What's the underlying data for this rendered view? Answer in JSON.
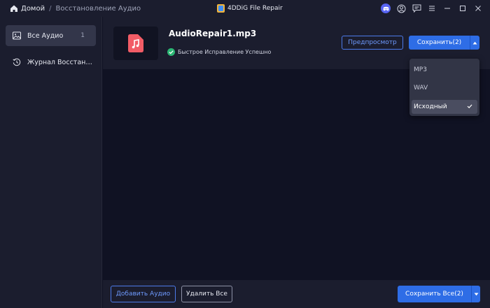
{
  "titlebar": {
    "home_label": "Домой",
    "separator": "/",
    "current_page": "Восстановление Аудио",
    "app_name": "4DDiG File Repair",
    "icons": [
      "discord-icon",
      "user-icon",
      "feedback-icon",
      "menu-icon",
      "minimize-icon",
      "maximize-icon",
      "close-icon"
    ]
  },
  "sidebar": {
    "items": [
      {
        "label": "Все Аудио",
        "count": "1",
        "icon": "image-icon",
        "active": true
      },
      {
        "label": "Журнал Восстановления",
        "icon": "history-icon",
        "active": false
      }
    ]
  },
  "file": {
    "name": "AudioRepair1.mp3",
    "status": "Быстрое Исправление Успешно",
    "thumb_icon": "music-file-icon"
  },
  "actions": {
    "preview_label": "Предпросмотр",
    "save_label": "Сохранить(2)"
  },
  "format_dropdown": {
    "options": [
      "MP3",
      "WAV",
      "Исходный"
    ],
    "selected": "Исходный"
  },
  "bottombar": {
    "add_label": "Добавить Аудио",
    "delete_label": "Удалить Все",
    "save_all_label": "Сохранить Все(2)"
  },
  "colors": {
    "accent": "#2e6de6",
    "background": "#101223",
    "panel": "#1b1d2e",
    "success": "#2bb673",
    "file_icon": "#f25c66"
  }
}
